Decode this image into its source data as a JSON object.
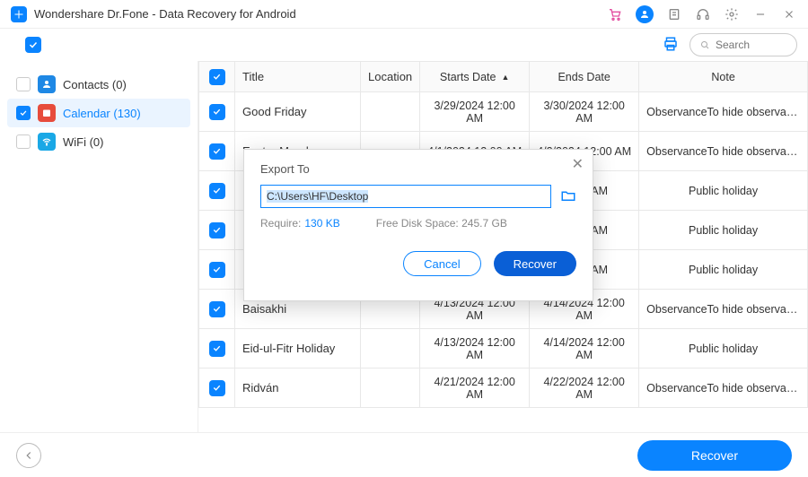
{
  "title": "Wondershare Dr.Fone - Data Recovery for Android",
  "search_placeholder": "Search",
  "sidebar": {
    "contacts": "Contacts (0)",
    "calendar": "Calendar (130)",
    "wifi": "WiFi (0)"
  },
  "headers": {
    "title": "Title",
    "location": "Location",
    "starts": "Starts Date",
    "ends": "Ends Date",
    "note": "Note"
  },
  "rows": [
    {
      "title": "Good Friday",
      "starts": "3/29/2024 12:00 AM",
      "ends": "3/30/2024 12:00 AM",
      "note": "ObservanceTo hide observances, go to..."
    },
    {
      "title": "Easter Monday",
      "starts": "4/1/2024 12:00 AM",
      "ends": "4/2/2024 12:00 AM",
      "note": "ObservanceTo hide observances, go to..."
    },
    {
      "title": "",
      "starts": "",
      "ends": "12:00 AM",
      "note": "Public holiday"
    },
    {
      "title": "",
      "starts": "",
      "ends": "12:00 AM",
      "note": "Public holiday"
    },
    {
      "title": "",
      "starts": "",
      "ends": "12:00 AM",
      "note": "Public holiday"
    },
    {
      "title": "Baisakhi",
      "starts": "4/13/2024 12:00 AM",
      "ends": "4/14/2024 12:00 AM",
      "note": "ObservanceTo hide observances, go to..."
    },
    {
      "title": "Eid-ul-Fitr Holiday",
      "starts": "4/13/2024 12:00 AM",
      "ends": "4/14/2024 12:00 AM",
      "note": "Public holiday"
    },
    {
      "title": "Ridván",
      "starts": "4/21/2024 12:00 AM",
      "ends": "4/22/2024 12:00 AM",
      "note": "ObservanceTo hide observances, go to..."
    }
  ],
  "modal": {
    "title": "Export To",
    "path": "C:\\Users\\HF\\Desktop",
    "require_label": "Require:",
    "require_value": "130 KB",
    "disk_label": "Free Disk Space:",
    "disk_value": "245.7 GB",
    "cancel": "Cancel",
    "recover": "Recover"
  },
  "footer": {
    "recover": "Recover"
  }
}
